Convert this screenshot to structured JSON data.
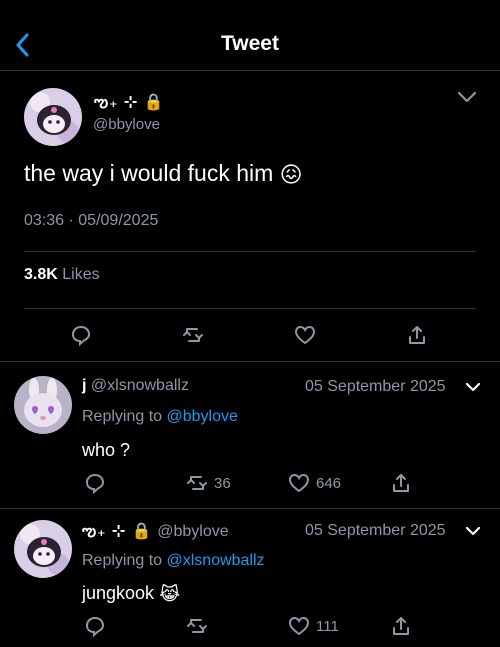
{
  "header": {
    "title": "Tweet"
  },
  "tweet": {
    "name_symbols": "ఌ₊ ⊹ 🔒",
    "handle": "@bbylove",
    "text": "the way i would fuck him",
    "emoji": "😖",
    "time": "03:36",
    "dot": "·",
    "date": "05/09/2025",
    "likes_count": "3.8K",
    "likes_label": "Likes"
  },
  "replies": [
    {
      "name": "j",
      "handle": "@xlsnowballz",
      "date": "05 September 2025",
      "replying_prefix": "Replying to",
      "replying_to": "@bbylove",
      "text": "who ?",
      "retweets": "36",
      "likes": "646"
    },
    {
      "name": "ఌ₊ ⊹ 🔒",
      "handle": "@bbylove",
      "date": "05 September 2025",
      "replying_prefix": "Replying to",
      "replying_to": "@xlsnowballz",
      "text": "jungkook",
      "emoji": "😹",
      "retweets": "",
      "likes": "111"
    }
  ],
  "colors": {
    "background": "#000000",
    "accent": "#1d9bf0",
    "muted": "#8b98a5",
    "divider": "#2f3336"
  }
}
